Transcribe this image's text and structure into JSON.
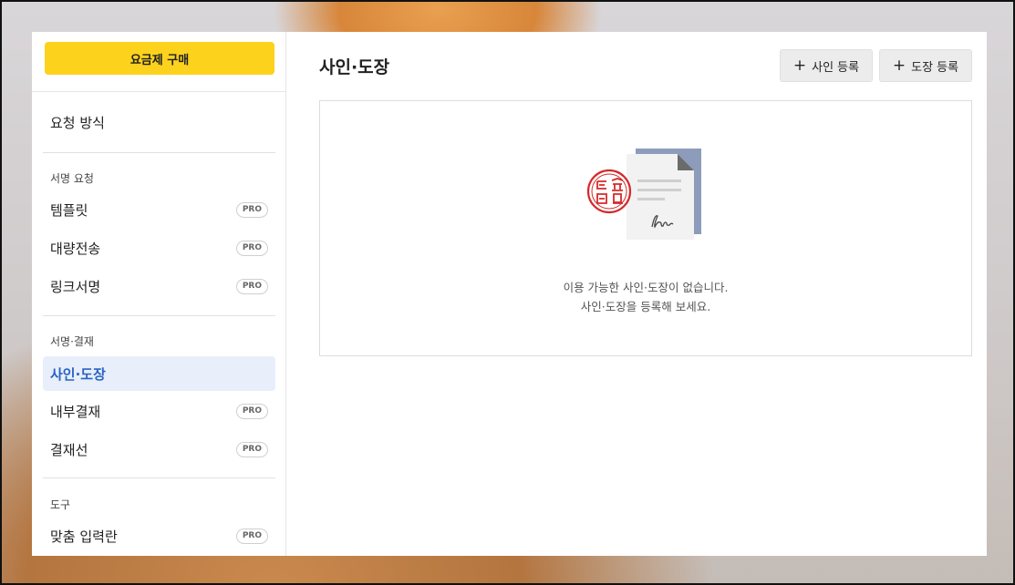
{
  "sidebar": {
    "buy_button": "요금제 구매",
    "request_method": "요청 방식",
    "section_sign_request": "서명 요청",
    "template": "템플릿",
    "bulk_send": "대량전송",
    "link_sign": "링크서명",
    "section_sign_approval": "서명·결재",
    "sign_stamp": "사인·도장",
    "internal_approval": "내부결재",
    "approval_line": "결재선",
    "section_tools": "도구",
    "custom_fields": "맞춤 입력란",
    "pro_badge": "PRO"
  },
  "main": {
    "title": "사인·도장",
    "add_sign_button": "사인 등록",
    "add_stamp_button": "도장 등록",
    "plus": "+",
    "empty_line1": "이용 가능한 사인·도장이 없습니다.",
    "empty_line2": "사인·도장을 등록해 보세요."
  },
  "colors": {
    "buy_button_bg": "#fcd21d",
    "active_bg": "#e8effb",
    "active_text": "#2a63c4",
    "stamp_red": "#d42a2a",
    "doc_blue": "#8d9cbb"
  },
  "icons": [
    "plus-icon",
    "stamp-icon",
    "document-signature-icon"
  ]
}
